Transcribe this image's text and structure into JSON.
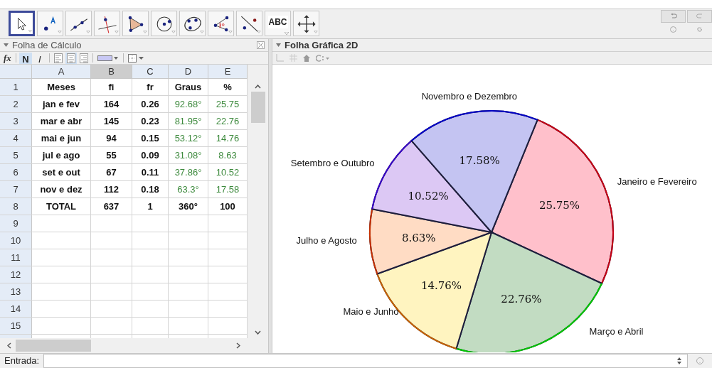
{
  "toolbar": {
    "tools": [
      {
        "kind": "move",
        "selected": true
      },
      {
        "kind": "point",
        "selected": false
      },
      {
        "kind": "line",
        "selected": false
      },
      {
        "kind": "perpendicular",
        "selected": false
      },
      {
        "kind": "polygon",
        "selected": false
      },
      {
        "kind": "circle",
        "selected": false
      },
      {
        "kind": "conic",
        "selected": false
      },
      {
        "kind": "angle",
        "selected": false
      },
      {
        "kind": "reflect",
        "selected": false
      },
      {
        "kind": "text",
        "label": "ABC",
        "selected": false
      },
      {
        "kind": "pan",
        "selected": false
      }
    ]
  },
  "spreadsheet": {
    "title": "Folha de Cálculo",
    "format_bar": [
      {
        "kind": "fx",
        "label": "fx"
      },
      {
        "kind": "bold",
        "label": "N",
        "selected": true
      },
      {
        "kind": "italic",
        "label": "I",
        "selected": false
      },
      {
        "kind": "align-left",
        "selected": false
      },
      {
        "kind": "align-center",
        "selected": true
      },
      {
        "kind": "align-right",
        "selected": false
      },
      {
        "kind": "fill-color"
      },
      {
        "kind": "border"
      }
    ],
    "columns": [
      {
        "label": "A",
        "selected": false
      },
      {
        "label": "B",
        "selected": true
      },
      {
        "label": "C",
        "selected": false
      },
      {
        "label": "D",
        "selected": false
      },
      {
        "label": "E",
        "selected": false
      }
    ],
    "rows": [
      {
        "number": "1",
        "cells": [
          {
            "text": "Meses",
            "kind": "bold"
          },
          {
            "text": "fi",
            "kind": "bold"
          },
          {
            "text": "fr",
            "kind": "bold"
          },
          {
            "text": "Graus",
            "kind": "bold"
          },
          {
            "text": "%",
            "kind": "bold"
          }
        ]
      },
      {
        "number": "2",
        "cells": [
          {
            "text": "jan e fev",
            "kind": "bold"
          },
          {
            "text": "164",
            "kind": "bold"
          },
          {
            "text": "0.26",
            "kind": "bold"
          },
          {
            "text": "92.68°",
            "kind": "derived"
          },
          {
            "text": "25.75",
            "kind": "derived"
          }
        ]
      },
      {
        "number": "3",
        "cells": [
          {
            "text": "mar e abr",
            "kind": "bold"
          },
          {
            "text": "145",
            "kind": "bold"
          },
          {
            "text": "0.23",
            "kind": "bold"
          },
          {
            "text": "81.95°",
            "kind": "derived"
          },
          {
            "text": "22.76",
            "kind": "derived"
          }
        ]
      },
      {
        "number": "4",
        "cells": [
          {
            "text": "mai e jun",
            "kind": "bold"
          },
          {
            "text": "94",
            "kind": "bold"
          },
          {
            "text": "0.15",
            "kind": "bold"
          },
          {
            "text": "53.12°",
            "kind": "derived"
          },
          {
            "text": "14.76",
            "kind": "derived"
          }
        ]
      },
      {
        "number": "5",
        "cells": [
          {
            "text": "jul e ago",
            "kind": "bold"
          },
          {
            "text": "55",
            "kind": "bold"
          },
          {
            "text": "0.09",
            "kind": "bold"
          },
          {
            "text": "31.08°",
            "kind": "derived"
          },
          {
            "text": "8.63",
            "kind": "derived"
          }
        ]
      },
      {
        "number": "6",
        "cells": [
          {
            "text": "set e out",
            "kind": "bold"
          },
          {
            "text": "67",
            "kind": "bold"
          },
          {
            "text": "0.11",
            "kind": "bold"
          },
          {
            "text": "37.86°",
            "kind": "derived"
          },
          {
            "text": "10.52",
            "kind": "derived"
          }
        ]
      },
      {
        "number": "7",
        "cells": [
          {
            "text": "nov e dez",
            "kind": "bold"
          },
          {
            "text": "112",
            "kind": "bold"
          },
          {
            "text": "0.18",
            "kind": "bold"
          },
          {
            "text": "63.3°",
            "kind": "derived"
          },
          {
            "text": "17.58",
            "kind": "derived"
          }
        ]
      },
      {
        "number": "8",
        "cells": [
          {
            "text": "TOTAL",
            "kind": "bold"
          },
          {
            "text": "637",
            "kind": "bold"
          },
          {
            "text": "1",
            "kind": "bold"
          },
          {
            "text": "360°",
            "kind": "bold"
          },
          {
            "text": "100",
            "kind": "bold"
          }
        ]
      },
      {
        "number": "9"
      },
      {
        "number": "10"
      },
      {
        "number": "11"
      },
      {
        "number": "12"
      },
      {
        "number": "13"
      },
      {
        "number": "14"
      },
      {
        "number": "15"
      }
    ]
  },
  "graphics": {
    "title": "Folha Gráfica 2D",
    "chart_data": {
      "type": "pie",
      "categories": [
        "Janeiro e Fevereiro",
        "Março e Abril",
        "Maio e Junho",
        "Julho e Agosto",
        "Setembro e Outubro",
        "Novembro e Dezembro"
      ],
      "values": [
        25.75,
        22.76,
        14.76,
        8.63,
        10.52,
        17.58
      ],
      "value_labels": [
        "25.75%",
        "22.76%",
        "14.76%",
        "8.63%",
        "10.52%",
        "17.58%"
      ],
      "colors": [
        "#ffc0cb",
        "#c2dcc2",
        "#fff4c0",
        "#ffdcc4",
        "#dcc8f4",
        "#c4c4f2"
      ]
    }
  },
  "input_bar": {
    "label": "Entrada:"
  }
}
